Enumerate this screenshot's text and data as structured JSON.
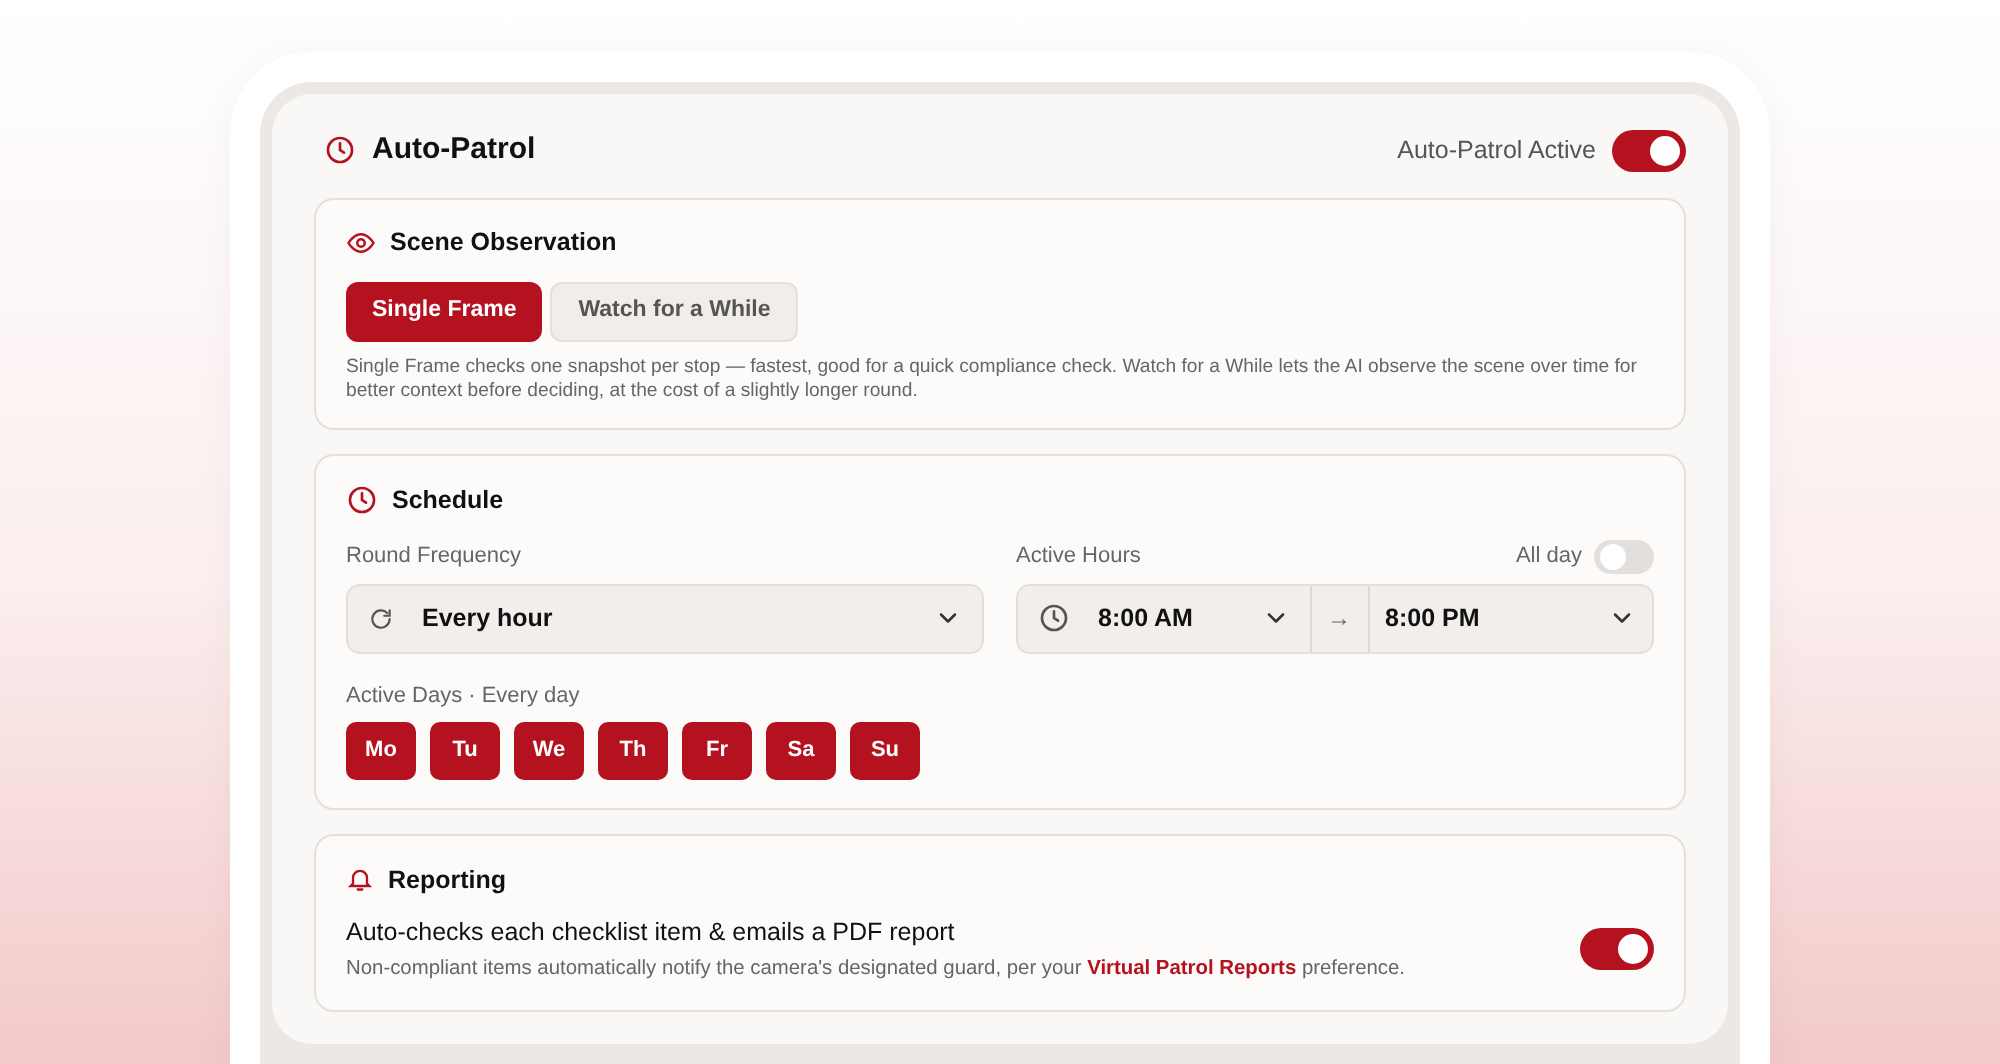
{
  "header": {
    "title": "Auto-Patrol",
    "active_label": "Auto-Patrol Active",
    "active_on": true
  },
  "scene": {
    "title": "Scene Observation",
    "modes": [
      {
        "label": "Single Frame",
        "selected": true
      },
      {
        "label": "Watch for a While",
        "selected": false
      }
    ],
    "description": "Single Frame checks one snapshot per stop — fastest, good for a quick compliance check. Watch for a While lets the AI observe the scene over time for better context before deciding, at the cost of a slightly longer round."
  },
  "schedule": {
    "title": "Schedule",
    "frequency_label": "Round Frequency",
    "frequency": "Every hour",
    "hours_label": "Active Hours",
    "all_day_label": "All day",
    "all_day_on": false,
    "start": "8:00 AM",
    "arrow": "→",
    "end": "8:00 PM",
    "days_label": "Active Days · Every day",
    "days": [
      {
        "label": "Mo",
        "selected": true
      },
      {
        "label": "Tu",
        "selected": true
      },
      {
        "label": "We",
        "selected": true
      },
      {
        "label": "Th",
        "selected": true
      },
      {
        "label": "Fr",
        "selected": true
      },
      {
        "label": "Sa",
        "selected": true
      },
      {
        "label": "Su",
        "selected": true
      }
    ]
  },
  "reporting": {
    "title": "Reporting",
    "heading": "Auto-checks each checklist item & emails a PDF report",
    "note_before": "Non-compliant items automatically notify the camera's designated guard, per your ",
    "note_link": "Virtual Patrol Reports",
    "note_after": " preference.",
    "on": true
  }
}
